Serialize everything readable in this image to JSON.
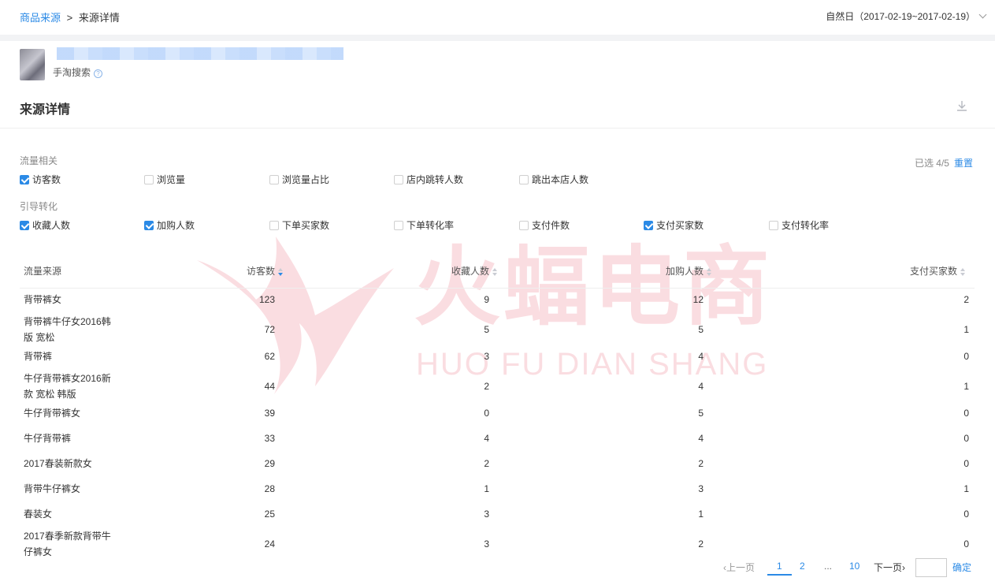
{
  "breadcrumb": {
    "parent": "商品来源",
    "separator": ">",
    "current": "来源详情"
  },
  "date_range": "自然日（2017-02-19~2017-02-19）",
  "source": {
    "subtitle": "手淘搜索",
    "help": "?"
  },
  "section_title": "来源详情",
  "filters": {
    "selected_label": "已选 4/5",
    "reset_label": "重置",
    "groups": [
      {
        "label": "流量相关",
        "items": [
          {
            "label": "访客数",
            "checked": true
          },
          {
            "label": "浏览量",
            "checked": false
          },
          {
            "label": "浏览量占比",
            "checked": false
          },
          {
            "label": "店内跳转人数",
            "checked": false
          },
          {
            "label": "跳出本店人数",
            "checked": false
          }
        ]
      },
      {
        "label": "引导转化",
        "items": [
          {
            "label": "收藏人数",
            "checked": true
          },
          {
            "label": "加购人数",
            "checked": true
          },
          {
            "label": "下单买家数",
            "checked": false
          },
          {
            "label": "下单转化率",
            "checked": false
          },
          {
            "label": "支付件数",
            "checked": false
          },
          {
            "label": "支付买家数",
            "checked": true
          },
          {
            "label": "支付转化率",
            "checked": false
          }
        ]
      }
    ]
  },
  "table": {
    "columns": [
      "流量来源",
      "访客数",
      "收藏人数",
      "加购人数",
      "支付买家数"
    ],
    "rows": [
      {
        "name": "背带裤女",
        "visitors": "123",
        "favorites": "9",
        "add_cart": "12",
        "buyers": "2"
      },
      {
        "name": "背带裤牛仔女2016韩版 宽松",
        "visitors": "72",
        "favorites": "5",
        "add_cart": "5",
        "buyers": "1"
      },
      {
        "name": "背带裤",
        "visitors": "62",
        "favorites": "3",
        "add_cart": "4",
        "buyers": "0"
      },
      {
        "name": "牛仔背带裤女2016新款 宽松 韩版",
        "visitors": "44",
        "favorites": "2",
        "add_cart": "4",
        "buyers": "1"
      },
      {
        "name": "牛仔背带裤女",
        "visitors": "39",
        "favorites": "0",
        "add_cart": "5",
        "buyers": "0"
      },
      {
        "name": "牛仔背带裤",
        "visitors": "33",
        "favorites": "4",
        "add_cart": "4",
        "buyers": "0"
      },
      {
        "name": "2017春装新款女",
        "visitors": "29",
        "favorites": "2",
        "add_cart": "2",
        "buyers": "0"
      },
      {
        "name": "背带牛仔裤女",
        "visitors": "28",
        "favorites": "1",
        "add_cart": "3",
        "buyers": "1"
      },
      {
        "name": "春装女",
        "visitors": "25",
        "favorites": "3",
        "add_cart": "1",
        "buyers": "0"
      },
      {
        "name": "2017春季新款背带牛仔裤女",
        "visitors": "24",
        "favorites": "3",
        "add_cart": "2",
        "buyers": "0"
      }
    ]
  },
  "pagination": {
    "prev": "上一页",
    "pages": [
      "1",
      "2"
    ],
    "dots": "...",
    "last": "10",
    "next": "下一页",
    "confirm": "确定"
  },
  "watermark": {
    "title": "火蝠电商",
    "subtitle": "HUO FU DIAN SHANG"
  },
  "colors": {
    "accent": "#2b8ae6",
    "watermark": "#e8475f"
  },
  "icons": {
    "download": "download-icon",
    "help": "help-icon",
    "chevron": "chevron-down-icon"
  }
}
